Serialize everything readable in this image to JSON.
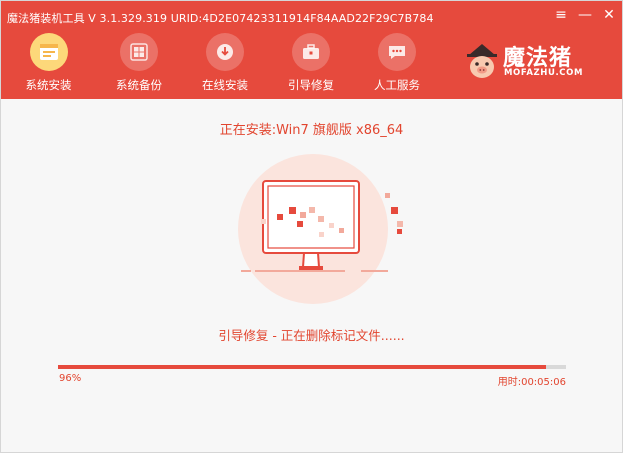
{
  "titlebar": {
    "title": "魔法猪装机工具 V 3.1.329.319 URID:4D2E07423311914F84AAD22F29C7B784",
    "menu_icon": "menu-icon",
    "minimize_icon": "minimize-icon",
    "close_icon": "close-icon"
  },
  "nav": {
    "items": [
      {
        "label": "系统安装",
        "icon": "system-install-icon",
        "active": true
      },
      {
        "label": "系统备份",
        "icon": "windows-backup-icon",
        "active": false
      },
      {
        "label": "在线安装",
        "icon": "download-icon",
        "active": false
      },
      {
        "label": "引导修复",
        "icon": "toolbox-icon",
        "active": false
      },
      {
        "label": "人工服务",
        "icon": "chat-icon",
        "active": false
      }
    ]
  },
  "brand": {
    "name": "魔法猪",
    "url": "MOFAZHU.COM"
  },
  "main": {
    "install_title": "正在安装:Win7 旗舰版 x86_64",
    "status_text": "引导修复 - 正在删除标记文件......",
    "progress_percent": 96,
    "progress_label": "96%",
    "elapsed": "用时:00:05:06"
  },
  "colors": {
    "accent": "#e64a3d",
    "text_accent": "#e2452f",
    "active_icon_bg": "#fdd87a",
    "background": "#f7f7f7"
  }
}
